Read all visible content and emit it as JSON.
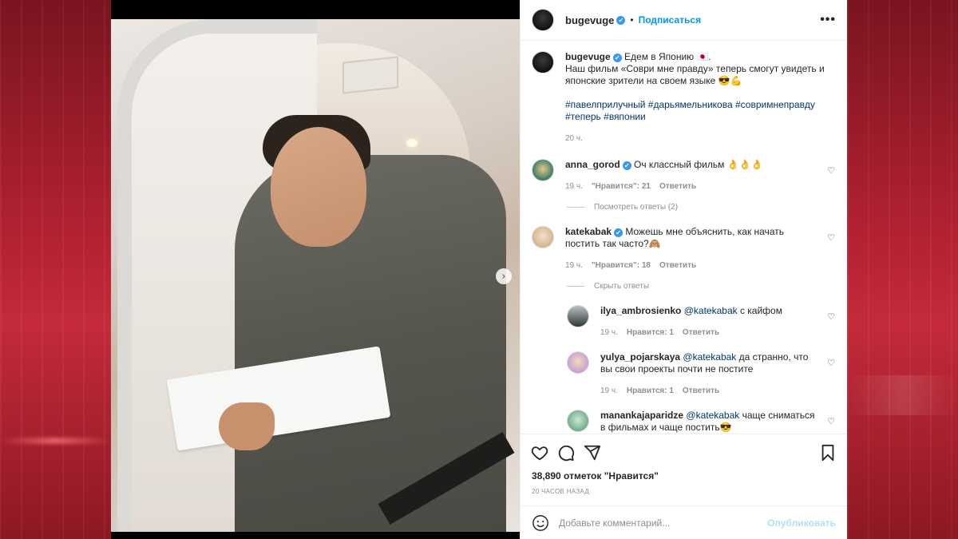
{
  "header": {
    "username": "bugevuge",
    "dot": "•",
    "follow_label": "Подписаться",
    "more_label": "•••"
  },
  "caption": {
    "username": "bugevuge",
    "text_line1": "Едем в Японию 🇯🇵.",
    "text_line2": "Наш фильм «Соври мне правду» теперь смогут увидеть и японские зрители на своем языке 😎💪",
    "hashtags": "#павелприлучный #дарьямельникова #совримнеправду #теперь #вяпонии",
    "time": "20 ч."
  },
  "comments": [
    {
      "username": "anna_gorod",
      "text": "Оч классный фильм 👌👌👌",
      "time": "19 ч.",
      "likes": "\"Нравится\": 21",
      "reply_label": "Ответить",
      "thread_label": "Посмотреть ответы (2)"
    },
    {
      "username": "katekabak",
      "text": "Можешь мне объяснить, как начать постить так часто?🙈",
      "time": "19 ч.",
      "likes": "\"Нравится\": 18",
      "reply_label": "Ответить",
      "thread_label": "Скрыть ответы"
    }
  ],
  "replies": [
    {
      "username": "ilya_ambrosienko",
      "mention": "@katekabak",
      "text": " с кайфом",
      "time": "19 ч.",
      "likes": "Нравится: 1",
      "reply_label": "Ответить"
    },
    {
      "username": "yulya_pojarskaya",
      "mention": "@katekabak",
      "text": " да странно, что вы свои проекты почти не постите",
      "time": "19 ч.",
      "likes": "Нравится: 1",
      "reply_label": "Ответить"
    },
    {
      "username": "manankajaparidze",
      "mention": "@katekabak",
      "text": " чаще сниматься в фильмах и чаще постить😎"
    }
  ],
  "footer": {
    "likes": "38,890 отметок \"Нравится\"",
    "ago": "20 ЧАСОВ НАЗАД",
    "comment_placeholder": "Добавьте комментарий...",
    "publish_label": "Опубликовать"
  },
  "icons": {
    "verified": "✔",
    "heart_small": "♡",
    "carousel_next": "›"
  }
}
